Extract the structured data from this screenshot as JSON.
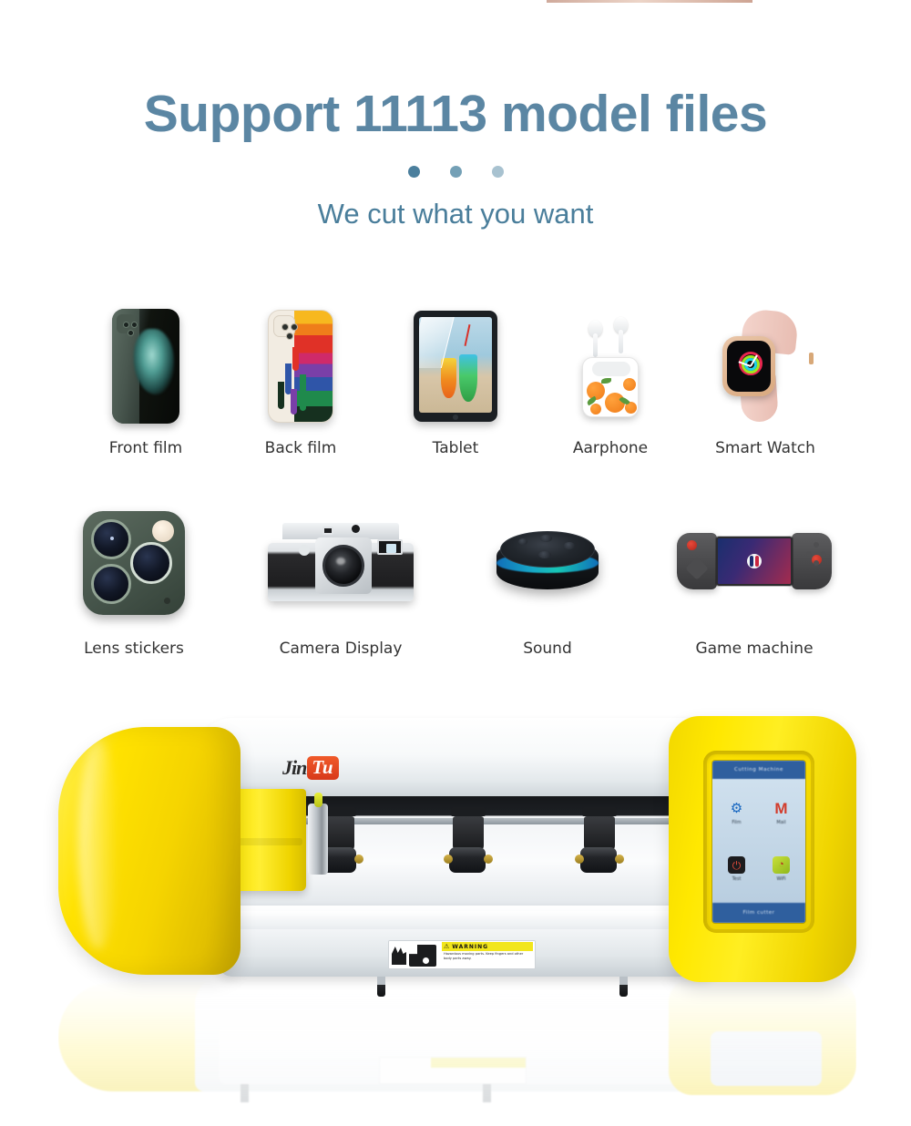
{
  "page": {
    "background_color": "#ffffff",
    "accent_color": "#5b86a3",
    "brand_yellow": "#ffe800",
    "brand_red": "#e0431f"
  },
  "header": {
    "title": "Support 11113 model files",
    "subtitle": "We cut what you want",
    "dots": [
      {
        "name": "dot-1",
        "color": "#4b7f9d"
      },
      {
        "name": "dot-2",
        "color": "#74a0b6"
      },
      {
        "name": "dot-3",
        "color": "#a8c2d0"
      }
    ]
  },
  "categories": {
    "row1": [
      {
        "label": "Front film",
        "icon": "phone-front-icon"
      },
      {
        "label": "Back film",
        "icon": "phone-back-icon"
      },
      {
        "label": "Tablet",
        "icon": "tablet-icon"
      },
      {
        "label": "Aarphone",
        "icon": "earbuds-icon"
      },
      {
        "label": "Smart Watch",
        "icon": "smartwatch-icon"
      }
    ],
    "row2": [
      {
        "label": "Lens stickers",
        "icon": "camera-lens-module-icon"
      },
      {
        "label": "Camera Display",
        "icon": "camera-icon"
      },
      {
        "label": "Sound",
        "icon": "smart-speaker-icon"
      },
      {
        "label": "Game machine",
        "icon": "handheld-console-icon"
      }
    ]
  },
  "machine": {
    "brand_first": "Jin",
    "brand_second": "Tu",
    "control_panel": {
      "titlebar": "Cutting Machine",
      "bottombar": "Film cutter",
      "apps": [
        {
          "label": "Film",
          "icon": "gear-icon",
          "glyph": "⚙"
        },
        {
          "label": "Mail",
          "icon": "mail-m-icon",
          "glyph": "M"
        },
        {
          "label": "Test",
          "icon": "power-icon",
          "glyph": "⏻"
        },
        {
          "label": "WiFi",
          "icon": "wifi-icon",
          "glyph": "◔"
        }
      ]
    },
    "warning_label": {
      "title": "WARNING",
      "triangle": "⚠",
      "body": "Hazardous moving parts. Keep fingers and other body parts away."
    }
  }
}
